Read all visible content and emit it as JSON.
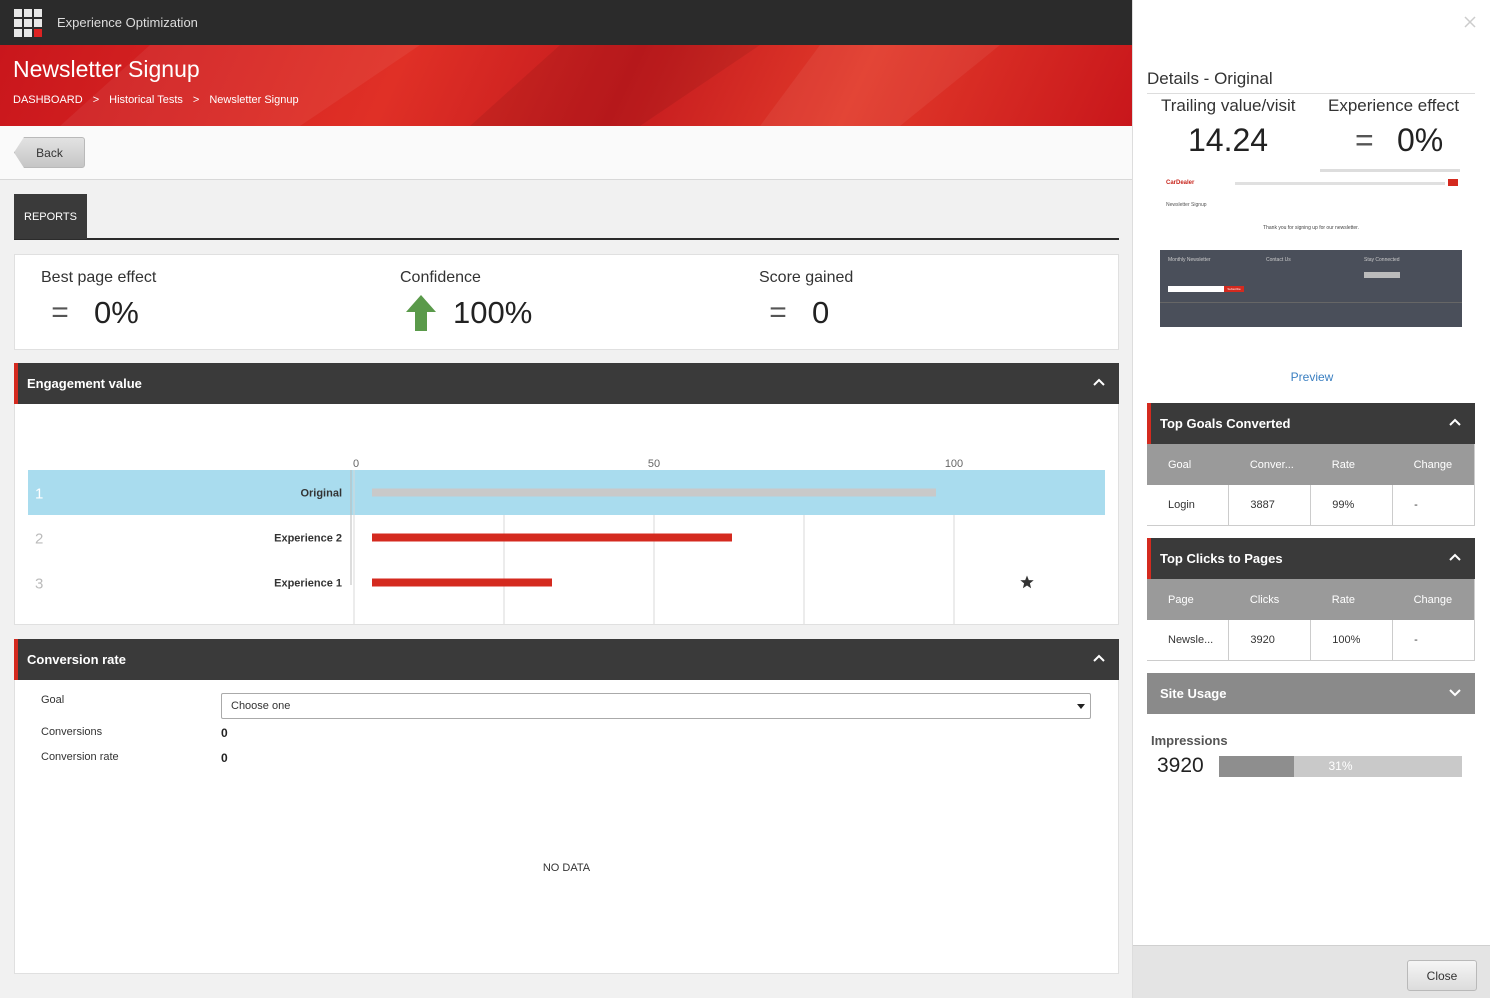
{
  "topbar": {
    "app_title": "Experience Optimization"
  },
  "header": {
    "title": "Newsletter Signup",
    "breadcrumb": [
      "DASHBOARD",
      "Historical Tests",
      "Newsletter Signup"
    ],
    "breadcrumb_separator": ">"
  },
  "toolbar": {
    "back_label": "Back"
  },
  "tabs": [
    {
      "label": "REPORTS"
    }
  ],
  "kpis": {
    "best_page_effect": {
      "label": "Best page effect",
      "symbol": "=",
      "value": "0%"
    },
    "confidence": {
      "label": "Confidence",
      "symbol": "up-arrow-icon",
      "value": "100%"
    },
    "score_gained": {
      "label": "Score gained",
      "symbol": "=",
      "value": "0"
    }
  },
  "engagement": {
    "title": "Engagement value",
    "chart_data": {
      "type": "bar",
      "orientation": "horizontal",
      "title": "",
      "xlim": [
        0,
        120
      ],
      "xticks": [
        0,
        50,
        100
      ],
      "xtick_labels": [
        "0",
        "50",
        "100"
      ],
      "categories": [
        "Original",
        "Experience 2",
        "Experience 1"
      ],
      "ranks": [
        "1",
        "2",
        "3"
      ],
      "values": [
        97,
        63,
        33
      ],
      "highlighted": "Original",
      "starred": "Experience 1",
      "colors": {
        "highlight_row": "#a9dcee",
        "original_bar": "#c9c9c9",
        "bar": "#d42a1f"
      }
    }
  },
  "conversion": {
    "title": "Conversion rate",
    "goal_label": "Goal",
    "goal_selected": "Choose one",
    "conversions_label": "Conversions",
    "conversions_value": "0",
    "rate_label": "Conversion rate",
    "rate_value": "0",
    "no_data": "NO DATA"
  },
  "side": {
    "title": "Details - Original",
    "trailing_label": "Trailing value/visit",
    "trailing_value": "14.24",
    "effect_label": "Experience effect",
    "effect_symbol": "=",
    "effect_value": "0%",
    "preview_link": "Preview",
    "thumbnail": {
      "brand": "CarDealer",
      "page_title": "Newsletter Signup",
      "message": "Thank you for signing up for our newsletter.",
      "footer_cols": [
        "Monthly Newsletter",
        "Contact Us",
        "Stay Connected"
      ],
      "subscribe": "Subscribe"
    },
    "top_goals": {
      "title": "Top Goals Converted",
      "columns": [
        "Goal",
        "Conver...",
        "Rate",
        "Change"
      ],
      "rows": [
        [
          "Login",
          "3887",
          "99%",
          "-"
        ]
      ]
    },
    "top_clicks": {
      "title": "Top Clicks to Pages",
      "columns": [
        "Page",
        "Clicks",
        "Rate",
        "Change"
      ],
      "rows": [
        [
          "Newsle...",
          "3920",
          "100%",
          "-"
        ]
      ]
    },
    "site_usage": {
      "title": "Site Usage"
    },
    "impressions": {
      "label": "Impressions",
      "value": "3920",
      "percent": 31,
      "percent_label": "31%"
    },
    "close_label": "Close"
  }
}
